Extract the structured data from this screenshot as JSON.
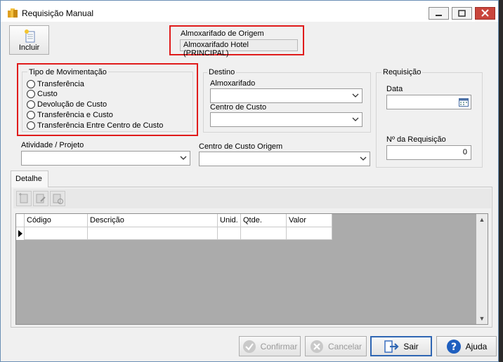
{
  "window": {
    "title": "Requisição Manual"
  },
  "toolbar": {
    "incluir_label": "Incluir"
  },
  "origem": {
    "label": "Almoxarifado de Origem",
    "value": "Almoxarifado Hotel (PRINCIPAL)"
  },
  "tipo_movimentacao": {
    "title": "Tipo de Movimentação",
    "options": [
      "Transferência",
      "Custo",
      "Devolução de Custo",
      "Transferência e Custo",
      "Transferência Entre Centro de Custo"
    ]
  },
  "destino": {
    "title": "Destino",
    "almoxarifado_label": "Almoxarifado",
    "centro_custo_label": "Centro de Custo"
  },
  "requisicao": {
    "title": "Requisição",
    "data_label": "Data",
    "numero_label": "Nº  da Requisição",
    "numero_value": "0"
  },
  "atividade": {
    "label": "Atividade / Projeto"
  },
  "centro_origem": {
    "label": "Centro de Custo Origem"
  },
  "detalhe": {
    "tab_label": "Detalhe",
    "columns": [
      "Código",
      "Descrição",
      "Unid.",
      "Qtde.",
      "Valor"
    ]
  },
  "buttons": {
    "confirmar": "Confirmar",
    "cancelar": "Cancelar",
    "sair": "Sair",
    "ajuda": "Ajuda"
  },
  "colors": {
    "highlight": "#e01b1b",
    "primary_border": "#2f66b3"
  }
}
